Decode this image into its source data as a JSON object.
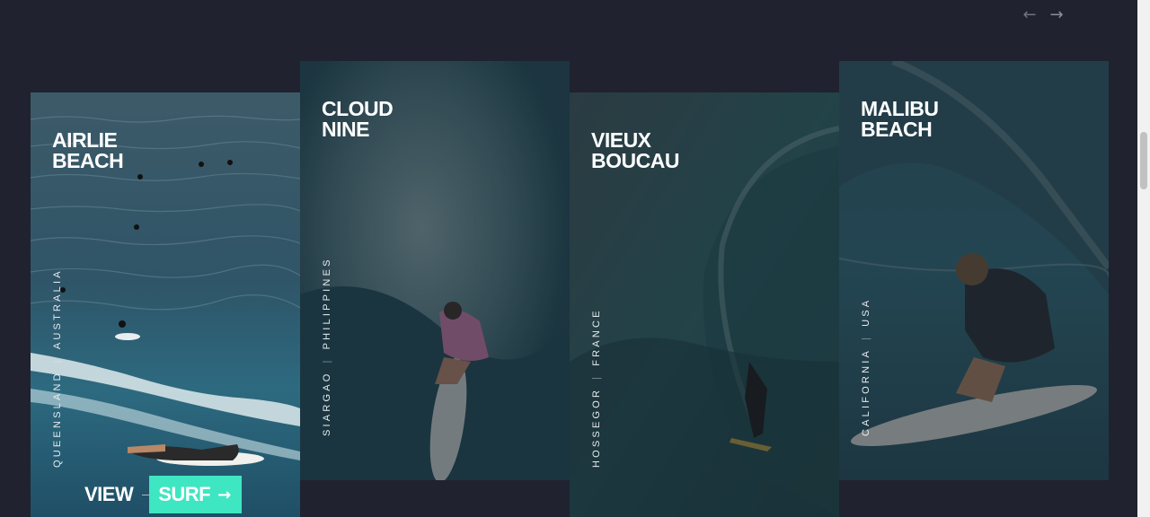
{
  "carousel": {
    "prev_icon": "←",
    "next_icon": "→"
  },
  "cards": [
    {
      "title": "AIRLIE\nBEACH",
      "region": "Queensland",
      "country": "Australia",
      "separator": "|"
    },
    {
      "title": "CLOUD\nNINE",
      "region": "Siargao",
      "country": "Philippines",
      "separator": "|"
    },
    {
      "title": "VIEUX\nBOUCAU",
      "region": "Hossegor",
      "country": "France",
      "separator": "|"
    },
    {
      "title": "MALIBU\nBEACH",
      "region": "California",
      "country": "USA",
      "separator": "|"
    }
  ],
  "cta": {
    "view_label": "VIEW",
    "surf_label": "SURF",
    "arrow": "→"
  },
  "colors": {
    "background": "#20222f",
    "accent": "#3ee6c1"
  }
}
